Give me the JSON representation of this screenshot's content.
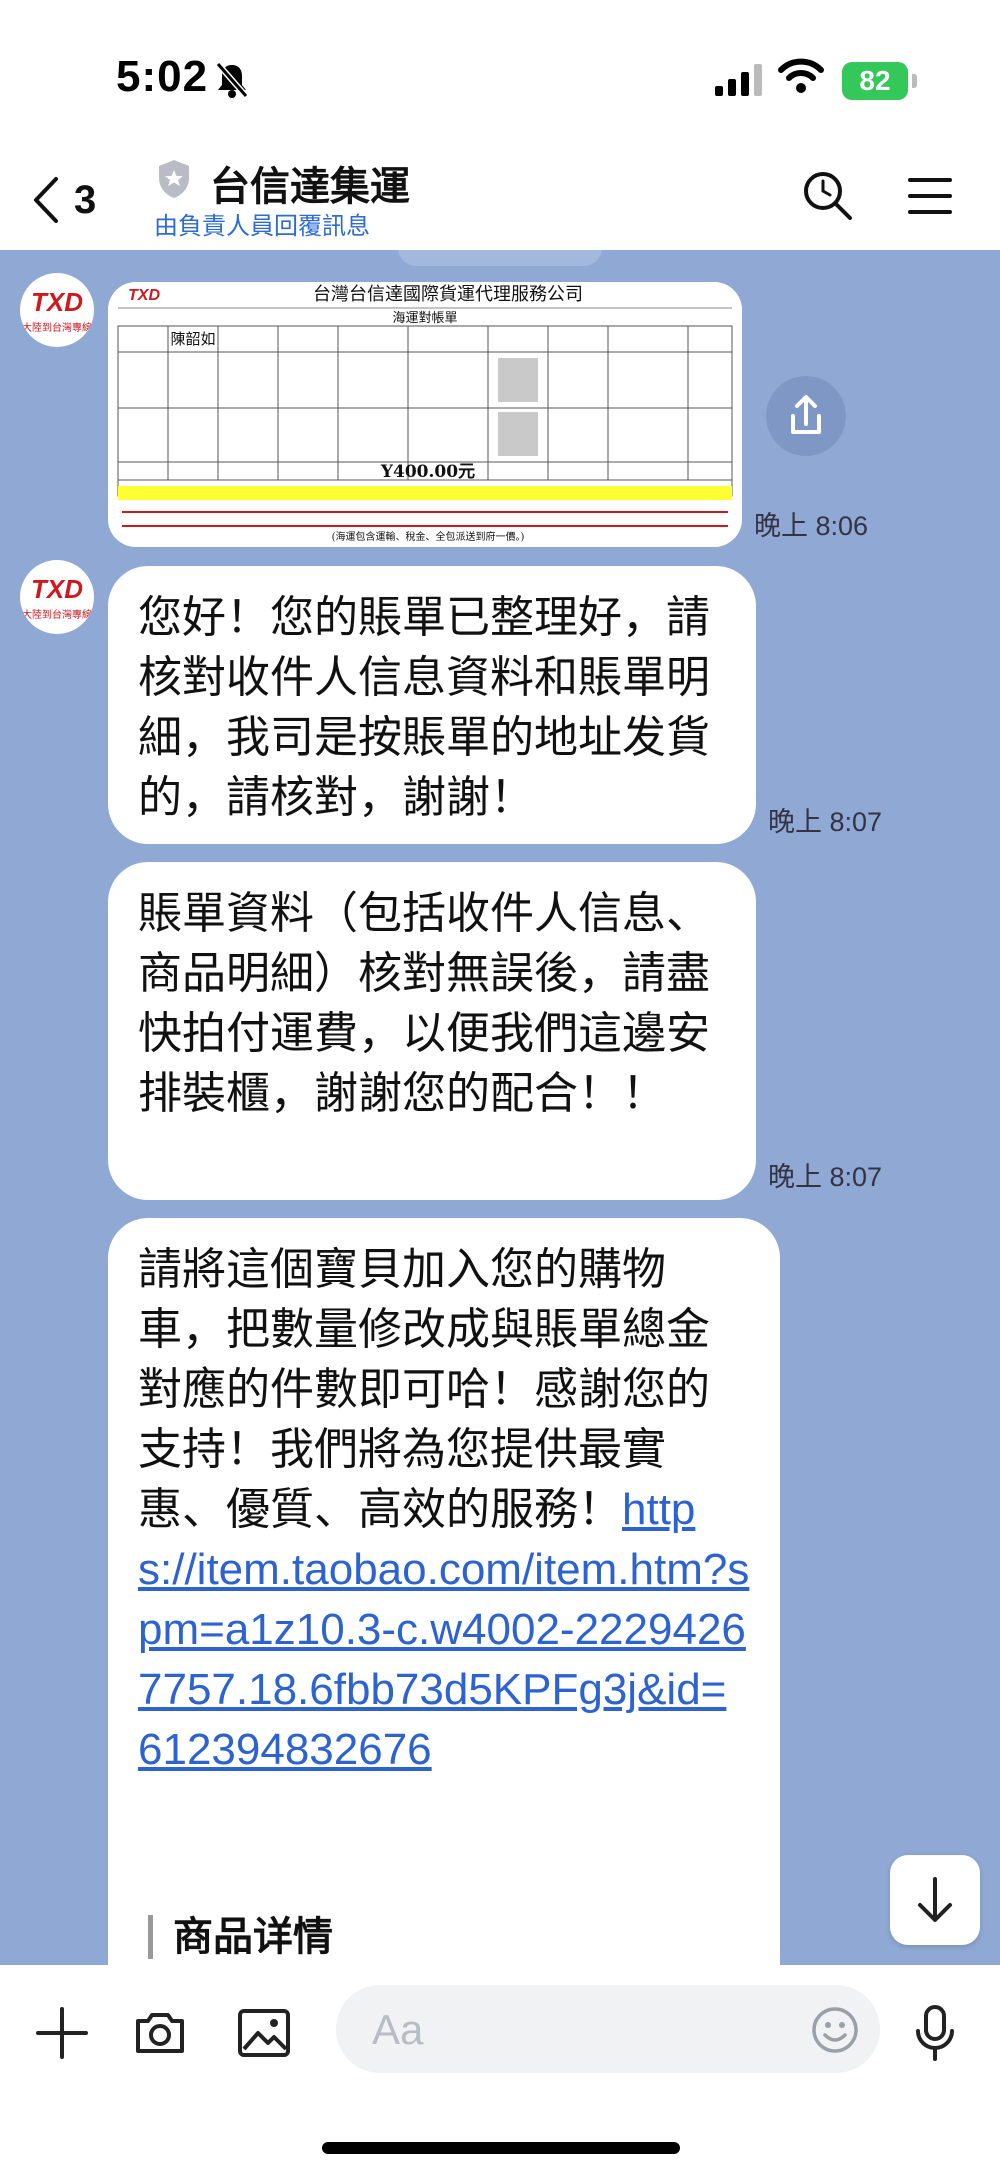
{
  "status_bar": {
    "time": "5:02",
    "battery": "82"
  },
  "header": {
    "back_count": "3",
    "title": "台信達集運",
    "subtitle": "由負責人員回覆訊息"
  },
  "image_message": {
    "company": "台灣台信達國際貨運代理服務公司",
    "sheet_title": "海運對帳單",
    "name": "陳韶如",
    "total": "Y400.00元",
    "total_note": "(海運包含運輸、稅金、全包派送到府一價。)",
    "logo": "TXD",
    "time": "晚上 8:06"
  },
  "avatar": {
    "logo": "TXD",
    "caption": "大陸到台灣專線"
  },
  "messages": [
    {
      "text": "您好！您的賬單已整理好，請核對收件人信息資料和賬單明細，我司是按賬單的地址发貨的，請核對，謝謝！",
      "time": "晚上 8:07"
    },
    {
      "text": "賬單資料（包括收件人信息、商品明細）核對無誤後，請盡快拍付運費，以便我們這邊安排裝櫃，謝謝您的配合！！",
      "time": "晚上 8:07"
    },
    {
      "text": "請將這個寶貝加入您的購物車，把數量修改成與賬單總金對應的件數即可哈！感謝您的支持！我們將為您提供最實惠、優質、高效的服務！",
      "url": "https://item.taobao.com/item.htm?spm=a1z10.3-c.w4002-22294267757.18.6fbb73d5KPFg3j&id=612394832676",
      "product_heading": "商品详情"
    }
  ],
  "input": {
    "placeholder": "Aa"
  }
}
